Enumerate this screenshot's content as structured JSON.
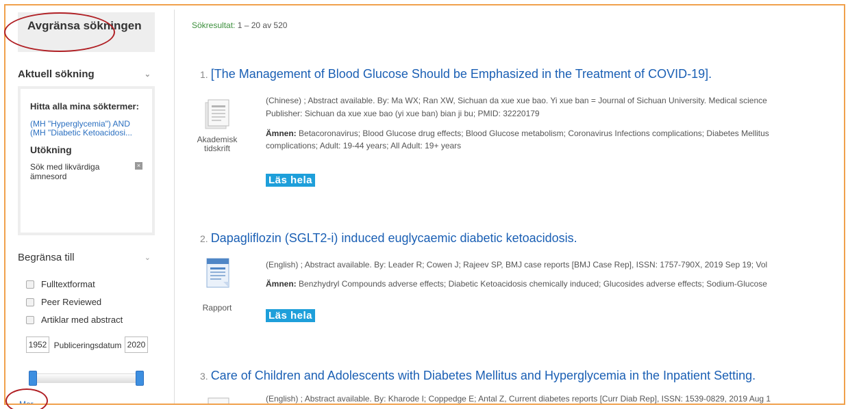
{
  "sidebar": {
    "title": "Avgränsa sökningen",
    "current_search": {
      "heading": "Aktuell sökning",
      "find_all": "Hitta alla mina söktermer:",
      "query": "(MH \"Hyperglycemia\") AND (MH \"Diabetic Ketoacidosi...",
      "expansion_heading": "Utökning",
      "expansion_item": "Sök med likvärdiga ämnesord"
    },
    "limit": {
      "heading": "Begränsa till",
      "options": [
        "Fulltextformat",
        "Peer Reviewed",
        "Artiklar med abstract"
      ],
      "year_from": "1952",
      "year_to": "2020",
      "date_label": "Publiceringsdatum",
      "more_link": "Mer"
    }
  },
  "results": {
    "count_label": "Sökresultat:",
    "count_value": "1 – 20 av 520",
    "items": [
      {
        "num": "1.",
        "title": "[The Management of Blood Glucose Should be Emphasized in the Treatment of COVID-19].",
        "doc_type": "Akademisk tidskrift",
        "line1": "(Chinese) ; Abstract available. By: Ma WX; Ran XW, Sichuan da xue xue bao. Yi xue ban = Journal of Sichuan University. Medical science",
        "line2": "Publisher: Sichuan da xue xue bao (yi xue ban) bian ji bu; PMID: 32220179",
        "subjects_label": "Ämnen:",
        "subjects1": "Betacoronavirus; Blood Glucose drug effects; Blood Glucose metabolism; Coronavirus Infections complications; Diabetes Mellitus",
        "subjects2": "complications; Adult: 19-44 years; All Adult: 19+ years",
        "read_label": "Läs hela"
      },
      {
        "num": "2.",
        "title": "Dapagliflozin (SGLT2-i) induced euglycaemic diabetic ketoacidosis.",
        "doc_type": "Rapport",
        "line1": "(English) ; Abstract available. By: Leader R; Cowen J; Rajeev SP, BMJ case reports [BMJ Case Rep], ISSN: 1757-790X, 2019 Sep 19; Vol",
        "subjects_label": "Ämnen:",
        "subjects1": "Benzhydryl Compounds adverse effects; Diabetic Ketoacidosis chemically induced; Glucosides adverse effects; Sodium-Glucose",
        "read_label": "Läs hela"
      },
      {
        "num": "3.",
        "title": "Care of Children and Adolescents with Diabetes Mellitus and Hyperglycemia in the Inpatient Setting.",
        "line1": "(English) ; Abstract available. By: Kharode I; Coppedge E; Antal Z, Current diabetes reports [Curr Diab Rep], ISSN: 1539-0829, 2019 Aug 1"
      }
    ]
  },
  "colors": {
    "frame": "#f0a04b",
    "annotation": "#b01f24",
    "link": "#1a5fb4",
    "read_button": "#1e9fda"
  },
  "icons": [
    "chevron-down-icon",
    "remove-icon",
    "journal-doc-icon",
    "report-doc-icon"
  ]
}
